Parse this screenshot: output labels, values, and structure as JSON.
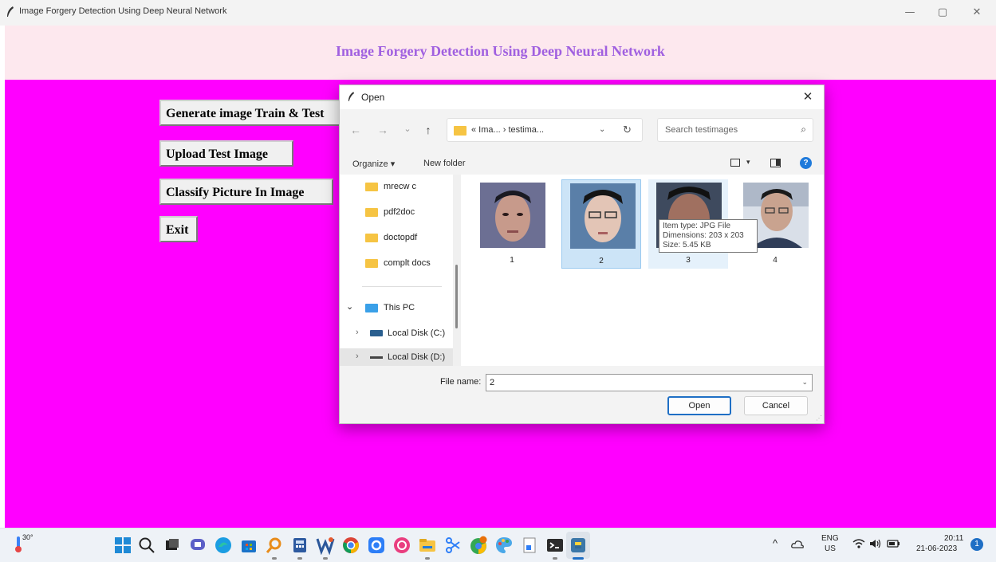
{
  "window": {
    "title": "Image Forgery Detection Using Deep Neural Network",
    "controls": {
      "minimize": "—",
      "maximize": "▢",
      "close": "✕"
    }
  },
  "app": {
    "heading": "Image Forgery Detection Using Deep Neural Network",
    "heading_color": "#a060e0",
    "canvas_color": "#ff00ff",
    "buttons": {
      "generate": "Generate image Train & Test",
      "upload": "Upload Test Image",
      "classify": "Classify Picture In Image",
      "exit": "Exit"
    }
  },
  "dialog": {
    "title": "Open",
    "close": "✕",
    "nav": {
      "back": "←",
      "forward": "→",
      "recent": "⌄",
      "up": "↑"
    },
    "address": {
      "path": "« Ima...  ›  testima...",
      "dropdown": "⌄",
      "refresh": "↻"
    },
    "search": {
      "placeholder": "Search testimages",
      "icon": "⌕"
    },
    "commands": {
      "organize": "Organize ▾",
      "new_folder": "New folder",
      "view_dropdown": "▾",
      "help": "?"
    },
    "nav_pane": {
      "folders": [
        "mrecw c",
        "pdf2doc",
        "doctopdf",
        "complt docs"
      ],
      "this_pc": "This PC",
      "drive_c": "Local Disk (C:)",
      "drive_d": "Local Disk (D:)",
      "expand_open": "⌄",
      "expand_closed": "›"
    },
    "files": [
      {
        "name": "1"
      },
      {
        "name": "2"
      },
      {
        "name": "3"
      },
      {
        "name": "4"
      }
    ],
    "tooltip": {
      "type": "Item type: JPG File",
      "dimensions": "Dimensions: 203 x 203",
      "size": "Size: 5.45 KB"
    },
    "file_name_label": "File name:",
    "file_name_value": "2",
    "file_name_dropdown": "⌄",
    "open_label": "Open",
    "cancel_label": "Cancel"
  },
  "taskbar": {
    "weather": "30°",
    "language": "ENG",
    "region": "US",
    "time": "20:11",
    "date": "21-06-2023",
    "notifications": "1",
    "tray_chevron": "^",
    "accent": "#1f6fc5"
  }
}
